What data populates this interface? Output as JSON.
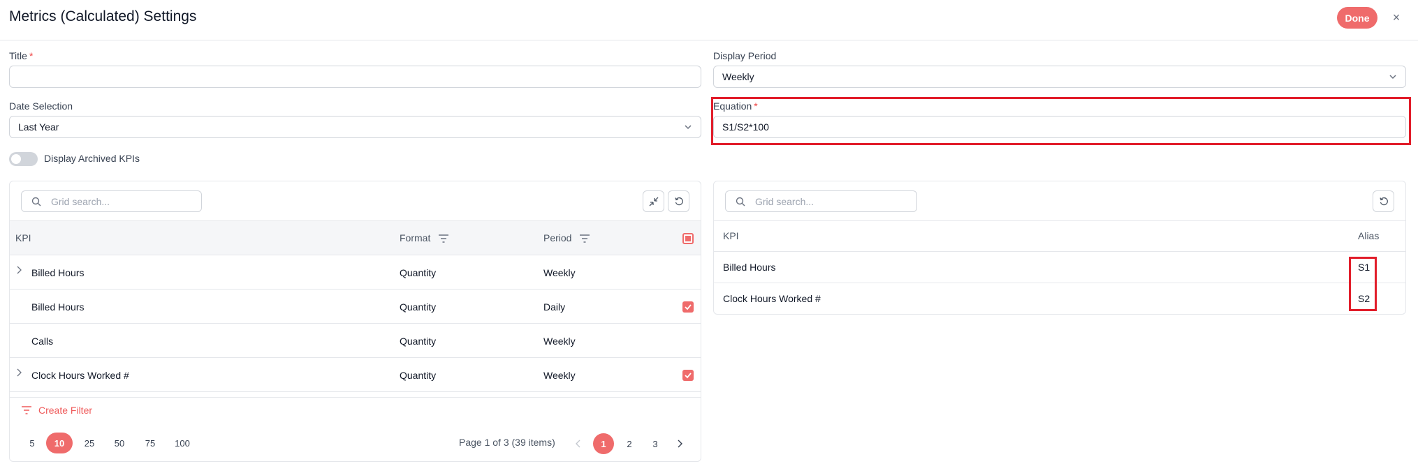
{
  "header": {
    "title": "Metrics (Calculated) Settings",
    "done_label": "Done",
    "close_icon": "×"
  },
  "form": {
    "title_label": "Title",
    "title_value": "",
    "required_mark": "*",
    "display_period_label": "Display Period",
    "display_period_value": "Weekly",
    "date_selection_label": "Date Selection",
    "date_selection_value": "Last Year",
    "equation_label": "Equation",
    "equation_value": "S1/S2*100",
    "archived_toggle_label": "Display Archived KPIs"
  },
  "left_grid": {
    "search_placeholder": "Grid search...",
    "columns": {
      "kpi": "KPI",
      "format": "Format",
      "period": "Period"
    },
    "rows": [
      {
        "kpi": "Billed Hours",
        "format": "Quantity",
        "period": "Weekly",
        "expandable": true,
        "checked": false
      },
      {
        "kpi": "Billed Hours",
        "format": "Quantity",
        "period": "Daily",
        "expandable": false,
        "checked": true
      },
      {
        "kpi": "Calls",
        "format": "Quantity",
        "period": "Weekly",
        "expandable": false,
        "checked": false
      },
      {
        "kpi": "Clock Hours Worked #",
        "format": "Quantity",
        "period": "Weekly",
        "expandable": true,
        "checked": true
      }
    ],
    "create_filter_label": "Create Filter",
    "page_sizes": [
      "5",
      "10",
      "25",
      "50",
      "75",
      "100"
    ],
    "active_page_size": "10",
    "page_info": "Page 1 of 3 (39 items)",
    "pages": [
      "1",
      "2",
      "3"
    ],
    "active_page": "1"
  },
  "right_grid": {
    "search_placeholder": "Grid search...",
    "columns": {
      "kpi": "KPI",
      "alias": "Alias"
    },
    "rows": [
      {
        "kpi": "Billed Hours",
        "alias": "S1"
      },
      {
        "kpi": "Clock Hours Worked #",
        "alias": "S2"
      }
    ]
  },
  "colors": {
    "accent": "#ef6b6b",
    "highlight": "#e11d2a"
  }
}
